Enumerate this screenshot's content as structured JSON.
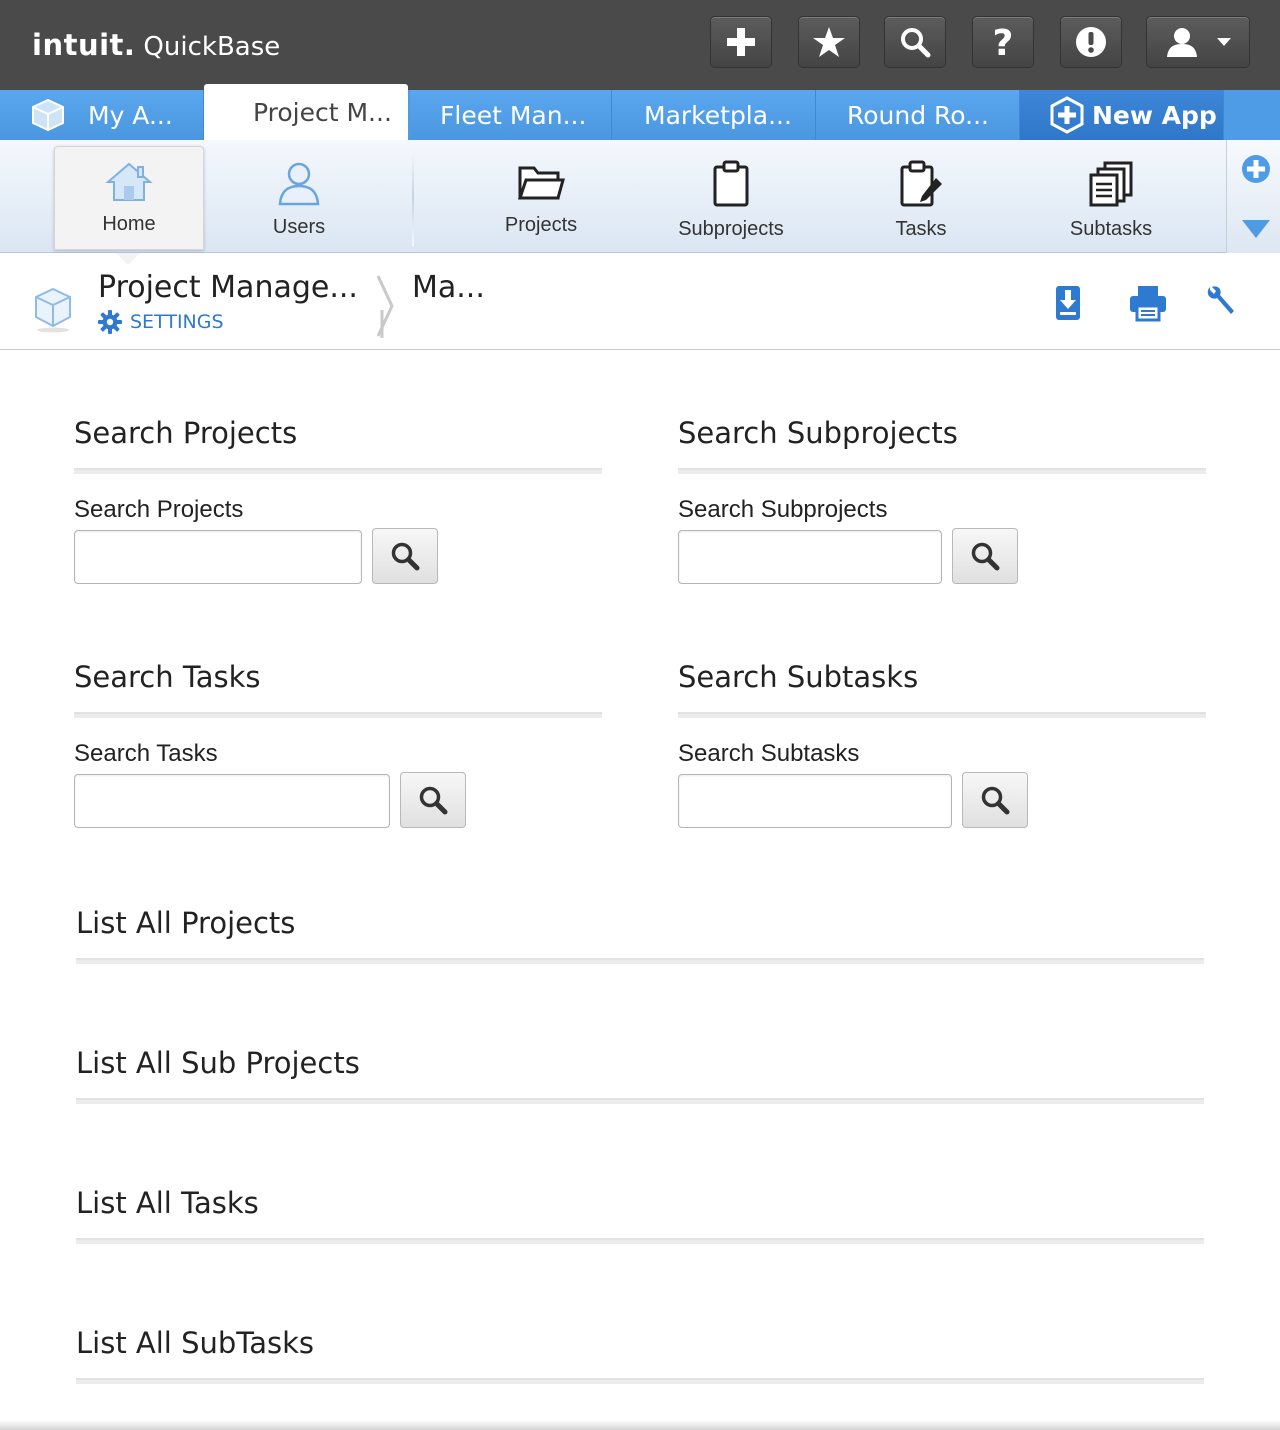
{
  "brand": {
    "intuit": "intuit.",
    "product": "QuickBase"
  },
  "topbar_icons": [
    "plus-icon",
    "star-icon",
    "search-icon",
    "help-icon",
    "alert-icon",
    "user-icon"
  ],
  "app_tabs": [
    {
      "label": "My A..."
    },
    {
      "label": "Project M..."
    },
    {
      "label": "Fleet Man..."
    },
    {
      "label": "Marketpla..."
    },
    {
      "label": "Round Ro..."
    },
    {
      "label": "New App"
    }
  ],
  "table_nav": [
    {
      "label": "Home",
      "icon": "home-icon"
    },
    {
      "label": "Users",
      "icon": "user-icon"
    },
    {
      "label": "Projects",
      "icon": "folder-icon"
    },
    {
      "label": "Subprojects",
      "icon": "clipboard-icon"
    },
    {
      "label": "Tasks",
      "icon": "clipboard-pencil-icon"
    },
    {
      "label": "Subtasks",
      "icon": "documents-icon"
    }
  ],
  "page_header": {
    "app_title": "Project Manage...",
    "settings_label": "SETTINGS",
    "breadcrumb": "Ma..."
  },
  "searches": [
    {
      "title": "Search Projects",
      "label": "Search Projects",
      "value": ""
    },
    {
      "title": "Search Subprojects",
      "label": "Search Subprojects",
      "value": ""
    },
    {
      "title": "Search Tasks",
      "label": "Search Tasks",
      "value": ""
    },
    {
      "title": "Search Subtasks",
      "label": "Search Subtasks",
      "value": ""
    }
  ],
  "lists": [
    {
      "title": "List All Projects"
    },
    {
      "title": "List All Sub Projects"
    },
    {
      "title": "List All Tasks"
    },
    {
      "title": "List All SubTasks"
    }
  ],
  "colors": {
    "topbar": "#4a4a4a",
    "tab_blue": "#4f9ce6",
    "link_blue": "#2e7ad0"
  }
}
